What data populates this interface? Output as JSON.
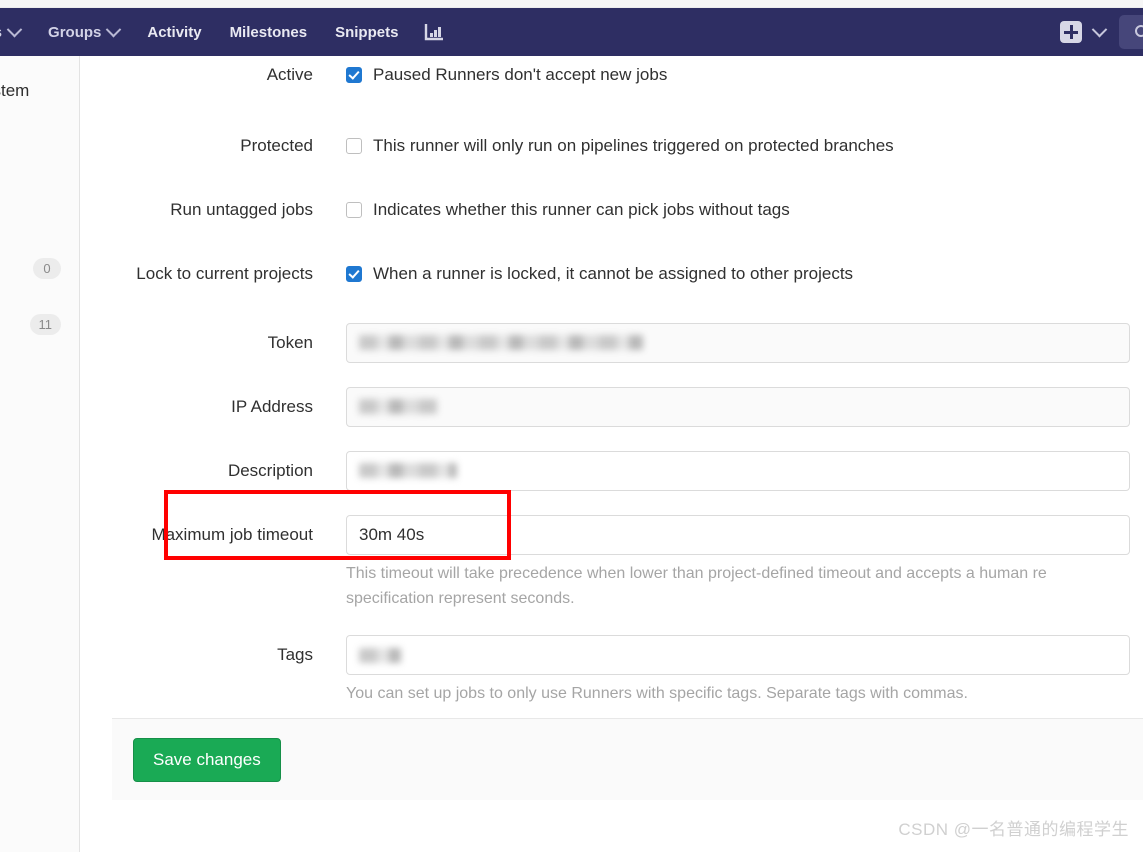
{
  "navbar": {
    "items": [
      {
        "label": "ects",
        "icon": "chevron-down-icon",
        "has_chevron": true,
        "clipped": true
      },
      {
        "label": "Groups",
        "icon": "chevron-down-icon",
        "has_chevron": true,
        "clipped": false
      },
      {
        "label": "Activity",
        "has_chevron": false,
        "clipped": false
      },
      {
        "label": "Milestones",
        "has_chevron": false,
        "clipped": false
      },
      {
        "label": "Snippets",
        "has_chevron": false,
        "clipped": false
      }
    ],
    "chart_icon": "analytics-chart-icon",
    "plus_icon": "plus-icon",
    "plus_chevron_icon": "chevron-down-icon",
    "search_icon": "search-icon",
    "background_color": "#2e2e63"
  },
  "sidebar": {
    "title": "ystem",
    "badges": [
      "0",
      "11"
    ]
  },
  "form": {
    "checkbox_rows": [
      {
        "label": "Active",
        "text": "Paused Runners don't accept new jobs",
        "checked": true
      },
      {
        "label": "Protected",
        "text": "This runner will only run on pipelines triggered on protected branches",
        "checked": false
      },
      {
        "label": "Run untagged jobs",
        "text": "Indicates whether this runner can pick jobs without tags",
        "checked": false
      },
      {
        "label": "Lock to current projects",
        "text": "When a runner is locked, it cannot be assigned to other projects",
        "checked": true
      }
    ],
    "token": {
      "label": "Token",
      "value": "",
      "redacted": true
    },
    "ip_address": {
      "label": "IP Address",
      "value": "",
      "redacted": true
    },
    "description": {
      "label": "Description",
      "value": "",
      "redacted": true
    },
    "maximum_job_timeout": {
      "label": "Maximum job timeout",
      "value": "30m 40s",
      "help": "This timeout will take precedence when lower than project-defined timeout and accepts a human re",
      "help_line2": "specification represent seconds."
    },
    "tags": {
      "label": "Tags",
      "value": "",
      "redacted": true,
      "help": "You can set up jobs to only use Runners with specific tags. Separate tags with commas."
    },
    "save_label": "Save changes",
    "save_color": "#1aaa55",
    "highlight_color": "#ff0000"
  },
  "watermark": "CSDN @一名普通的编程学生"
}
